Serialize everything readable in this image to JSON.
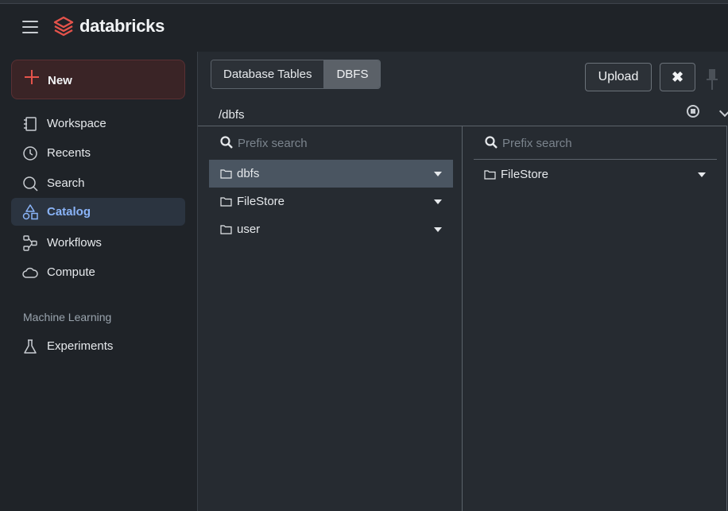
{
  "brand": {
    "name": "databricks"
  },
  "sidebar": {
    "new_label": "New",
    "items": [
      {
        "label": "Workspace",
        "icon": "workspace-icon",
        "active": false
      },
      {
        "label": "Recents",
        "icon": "clock-icon",
        "active": false
      },
      {
        "label": "Search",
        "icon": "search-icon",
        "active": false
      },
      {
        "label": "Catalog",
        "icon": "catalog-icon",
        "active": true
      },
      {
        "label": "Workflows",
        "icon": "workflows-icon",
        "active": false
      },
      {
        "label": "Compute",
        "icon": "cloud-icon",
        "active": false
      }
    ],
    "section_label": "Machine Learning",
    "ml_items": [
      {
        "label": "Experiments",
        "icon": "flask-icon"
      }
    ]
  },
  "dialog": {
    "tabs": [
      {
        "label": "Database Tables",
        "selected": false
      },
      {
        "label": "DBFS",
        "selected": true
      }
    ],
    "upload_label": "Upload",
    "close_symbol": "✖",
    "path": "/dbfs",
    "column1": {
      "search_placeholder": "Prefix search",
      "rows": [
        {
          "label": "dbfs",
          "selected": true
        },
        {
          "label": "FileStore",
          "selected": false
        },
        {
          "label": "user",
          "selected": false
        }
      ]
    },
    "column2": {
      "search_placeholder": "Prefix search",
      "rows": [
        {
          "label": "FileStore",
          "selected": false
        }
      ]
    }
  },
  "colors": {
    "background": "#1f2328",
    "panel": "#262b31",
    "accent_red": "#e5534b",
    "active_blue": "#8ab4f8",
    "selected_row": "#4a5561"
  }
}
